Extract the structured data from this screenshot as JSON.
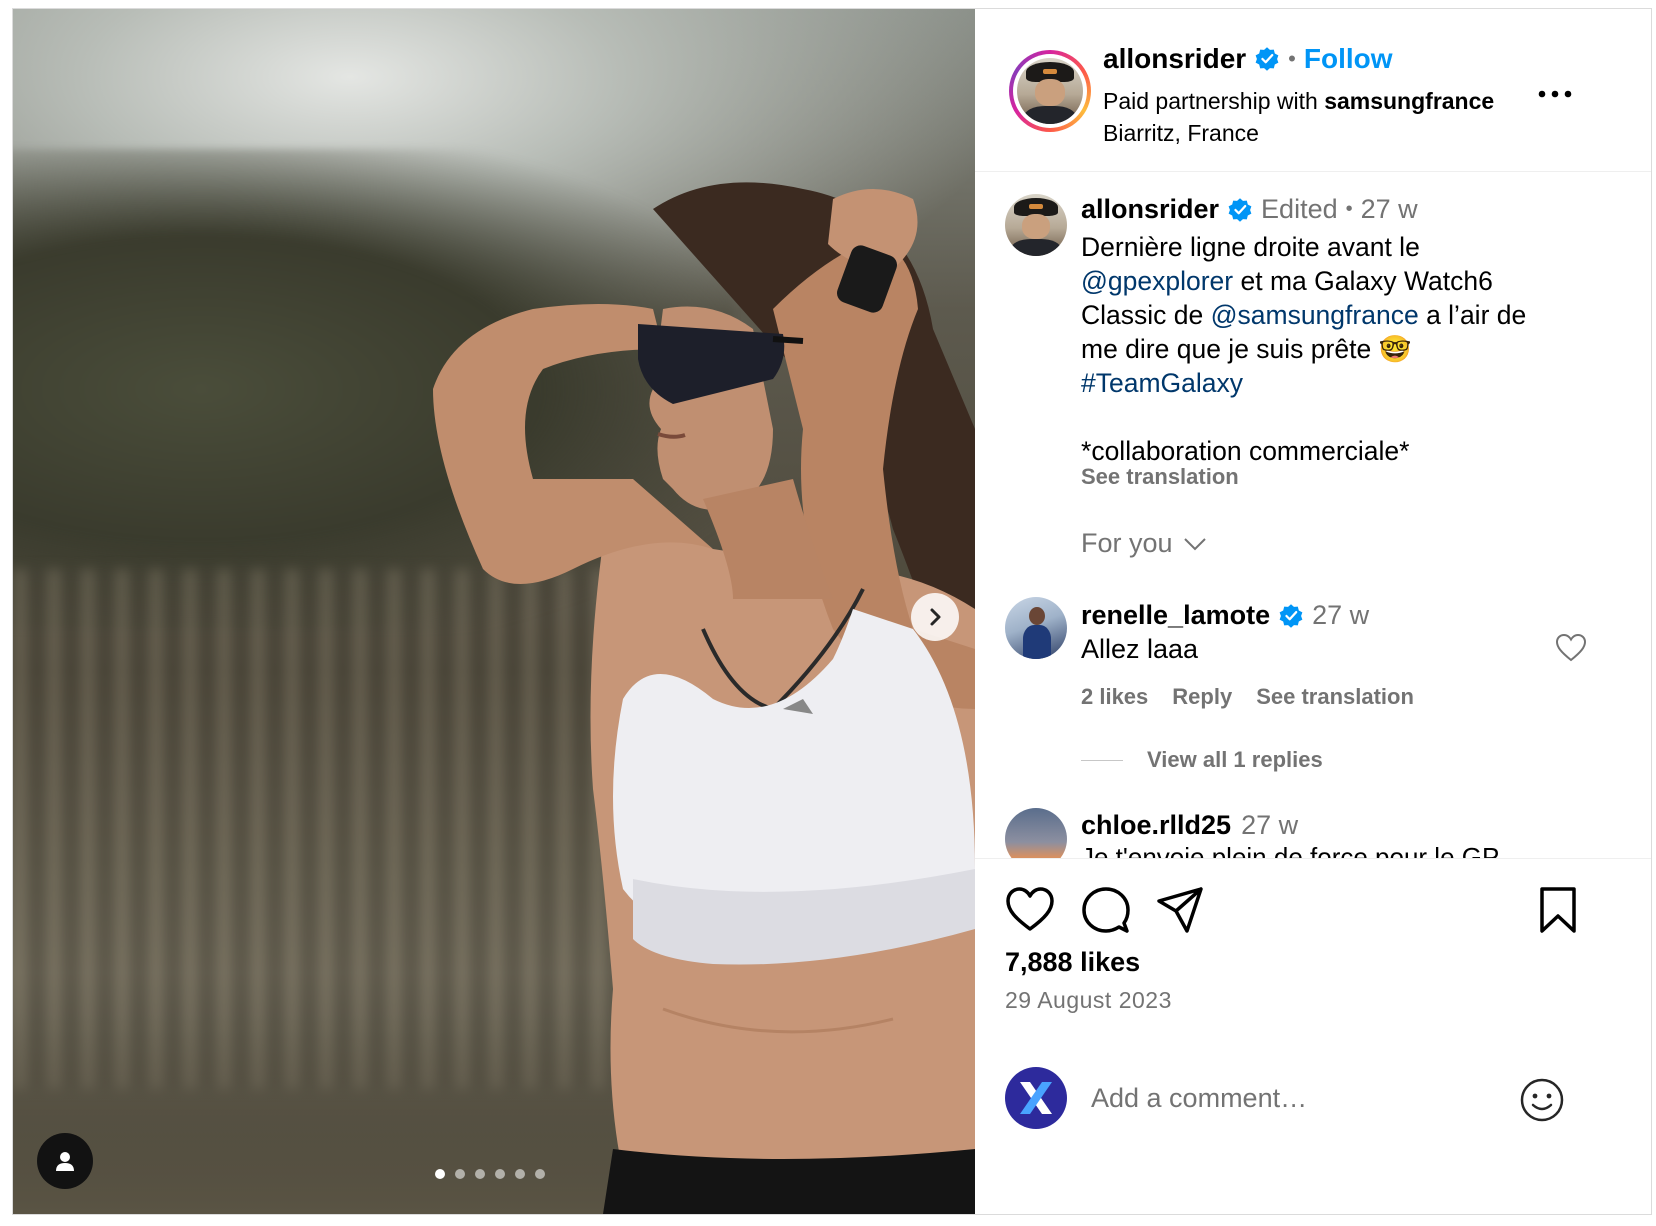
{
  "header": {
    "username": "allonsrider",
    "separator": "•",
    "follow_label": "Follow",
    "partnership_prefix": "Paid partnership with",
    "partner": "samsungfrance",
    "location": "Biarritz, France"
  },
  "caption": {
    "username": "allonsrider",
    "edited_label": "Edited",
    "separator": "•",
    "time": "27 w",
    "lines": [
      {
        "pre": "Dernière ligne droite avant le",
        "link": "",
        "post": ""
      },
      {
        "pre": "",
        "link": "@gpexplorer",
        "post": " et ma Galaxy Watch6"
      },
      {
        "pre": "Classic de ",
        "link": "@samsungfrance",
        "post": " a l’air de"
      },
      {
        "pre": "me dire que je suis prête 🤓",
        "link": "",
        "post": ""
      },
      {
        "pre": "",
        "link": "#TeamGalaxy",
        "post": ""
      }
    ],
    "footer": "*collaboration commerciale*",
    "see_translation": "See translation"
  },
  "filter": {
    "label": "For you"
  },
  "comments": [
    {
      "username": "renelle_lamote",
      "time": "27 w",
      "text": "Allez laaa",
      "likes": "2 likes",
      "reply_label": "Reply",
      "see_translation": "See translation",
      "view_replies": "View all 1 replies"
    },
    {
      "username": "chloe.rlld25",
      "time": "27 w",
      "text": "Je t'envoie plein de force pour le GP"
    }
  ],
  "actions": {
    "likes": "7,888 likes",
    "date": "29 August 2023",
    "comment_placeholder": "Add a comment…"
  },
  "carousel": {
    "total": 6,
    "active_index": 0
  },
  "colors": {
    "accent": "#0095f6",
    "verified": "#0095f6",
    "link": "#00376b",
    "muted": "#737373"
  },
  "icons": [
    "verified-badge-icon",
    "more-options-icon",
    "chevron-down-icon",
    "heart-icon",
    "comment-icon",
    "share-icon",
    "bookmark-icon",
    "emoji-icon",
    "chevron-right-icon",
    "user-tag-icon"
  ]
}
